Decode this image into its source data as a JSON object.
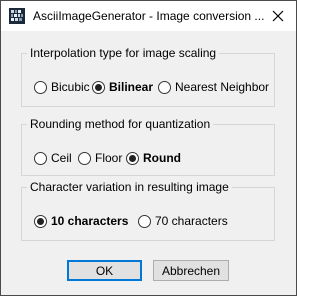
{
  "window": {
    "title": "AsciiImageGenerator - Image conversion ..."
  },
  "interpolation": {
    "legend": "Interpolation type for image scaling",
    "options": [
      {
        "label": "Bicubic",
        "checked": false
      },
      {
        "label": "Bilinear",
        "checked": true
      },
      {
        "label": "Nearest Neighbor",
        "checked": false
      }
    ]
  },
  "rounding": {
    "legend": "Rounding method for quantization",
    "options": [
      {
        "label": "Ceil",
        "checked": false
      },
      {
        "label": "Floor",
        "checked": false
      },
      {
        "label": "Round",
        "checked": true
      }
    ]
  },
  "variation": {
    "legend": "Character variation in resulting image",
    "options": [
      {
        "label": "10 characters",
        "checked": true
      },
      {
        "label": "70 characters",
        "checked": false
      }
    ]
  },
  "buttons": {
    "ok": "OK",
    "cancel": "Abbrechen"
  },
  "icons": {
    "app": "app-icon",
    "close": "close-icon"
  },
  "colors": {
    "accent": "#0078d7",
    "background": "#f0f0f0"
  }
}
